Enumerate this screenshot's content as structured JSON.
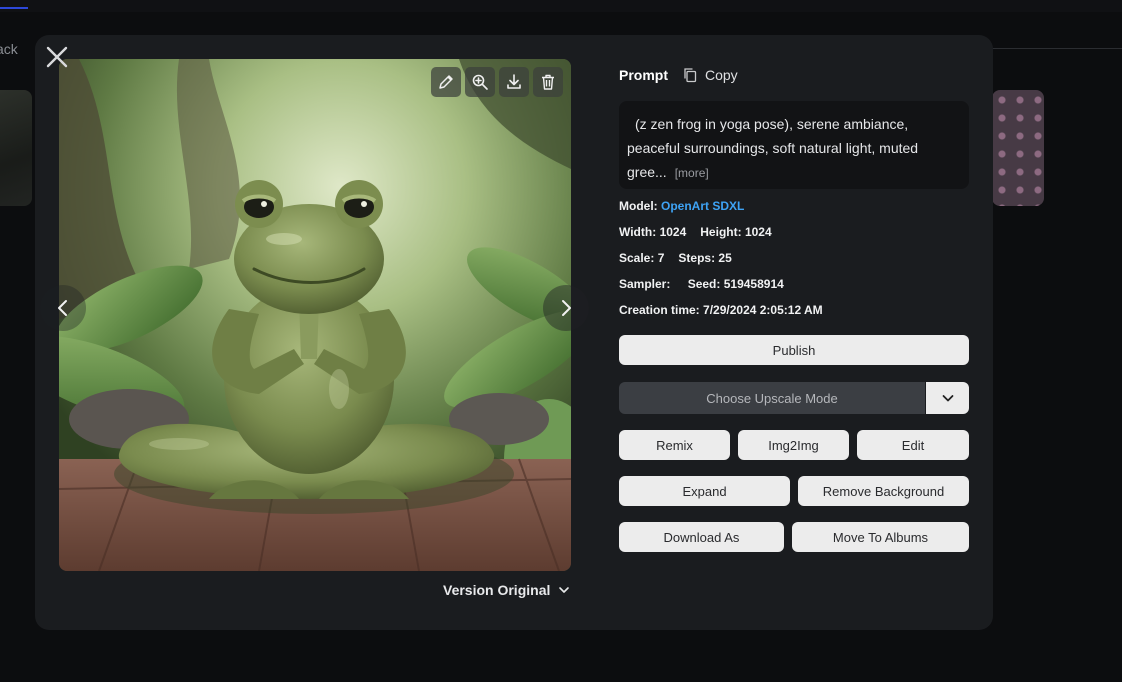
{
  "background": {
    "back_label": "ack"
  },
  "modal": {
    "prompt_title": "Prompt",
    "copy_label": "Copy",
    "prompt_line1": "(z zen frog in yoga pose), serene ambiance,",
    "prompt_line2": "peaceful surroundings, soft natural light, muted",
    "prompt_line3": "gree...",
    "more_label": "[more]",
    "meta": {
      "model_label": "Model:",
      "model_value": "OpenArt SDXL",
      "width_label": "Width:",
      "width_value": "1024",
      "height_label": "Height:",
      "height_value": "1024",
      "scale_label": "Scale:",
      "scale_value": "7",
      "steps_label": "Steps:",
      "steps_value": "25",
      "sampler_label": "Sampler:",
      "sampler_value": "",
      "seed_label": "Seed:",
      "seed_value": "519458914",
      "creation_label": "Creation time:",
      "creation_value": "7/29/2024 2:05:12 AM"
    },
    "buttons": {
      "publish": "Publish",
      "upscale_placeholder": "Choose Upscale Mode",
      "remix": "Remix",
      "img2img": "Img2Img",
      "edit": "Edit",
      "expand": "Expand",
      "remove_background": "Remove Background",
      "download_as": "Download As",
      "move_to_albums": "Move To Albums"
    },
    "version_label": "Version Original",
    "toolbar_icons": [
      "pencil-icon",
      "zoom-in-icon",
      "download-icon",
      "trash-icon"
    ],
    "colors": {
      "modal_bg": "#1a1c1f",
      "link": "#3ea3f5",
      "button_bg": "#ececec",
      "upscale_bg": "#3b3e43"
    }
  }
}
